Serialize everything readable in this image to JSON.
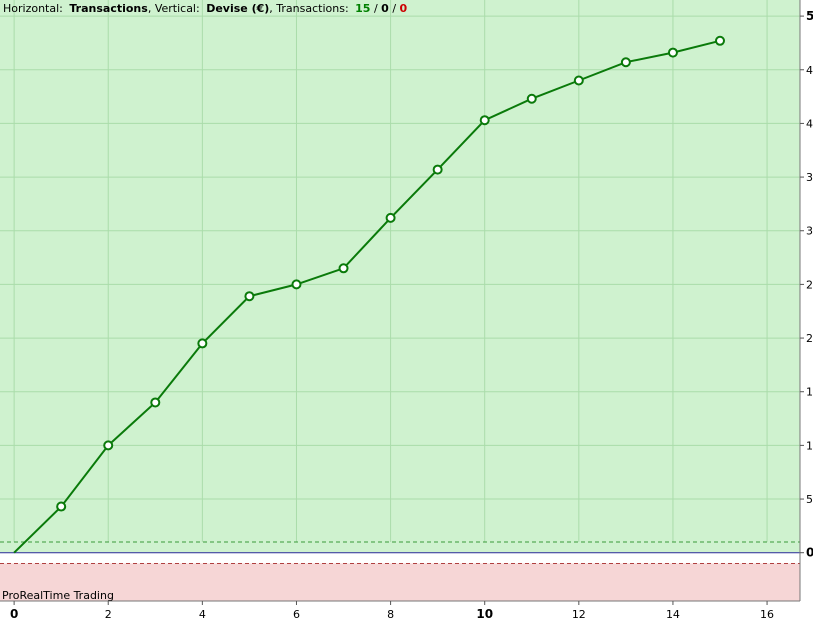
{
  "header": {
    "horizontal_label": "Horizontal:",
    "horizontal_value": "Transactions",
    "sep1": ", ",
    "vertical_label": "Vertical:",
    "vertical_value": "Devise (€)",
    "sep2": ", ",
    "transactions_label": "Transactions:",
    "count_win": "15",
    "slash1": " / ",
    "count_neutral": "0",
    "slash2": " / ",
    "count_loss": "0"
  },
  "watermark": "ProRealTime Trading",
  "colors": {
    "positive_zone": "#cff2cf",
    "negative_zone": "#f6d6d6",
    "line": "#0a7a0a",
    "zero_line": "#2b2b9a",
    "grid": "#aadcaa",
    "win": "#008000",
    "loss": "#cc0000"
  },
  "chart_data": {
    "type": "line",
    "x": [
      0,
      1,
      2,
      3,
      4,
      5,
      6,
      7,
      8,
      9,
      10,
      11,
      12,
      13,
      14,
      15
    ],
    "values": [
      0,
      430,
      1000,
      1400,
      1950,
      2390,
      2500,
      2650,
      3120,
      3570,
      4030,
      4230,
      4400,
      4570,
      4660,
      4770
    ],
    "xlim": [
      -0.3,
      16.7
    ],
    "ylim": [
      -450,
      5150
    ],
    "x_ticks": [
      0,
      2,
      4,
      6,
      8,
      10,
      12,
      14,
      16
    ],
    "x_tick_labels": [
      "0",
      "2",
      "4",
      "6",
      "8",
      "10",
      "12",
      "14",
      "16"
    ],
    "x_bold_ticks": [
      0,
      10
    ],
    "y_ticks": [
      0,
      500,
      1000,
      1500,
      2000,
      2500,
      3000,
      3500,
      4000,
      4500,
      5000
    ],
    "y_tick_labels": [
      "0",
      "5",
      "1",
      "1",
      "2",
      "2",
      "3",
      "3",
      "4",
      "4",
      "5"
    ],
    "y_bold_ticks": [
      0,
      5000
    ],
    "band_upper": 100,
    "band_lower": -100,
    "grid": true,
    "title": "",
    "xlabel": "",
    "ylabel": ""
  }
}
